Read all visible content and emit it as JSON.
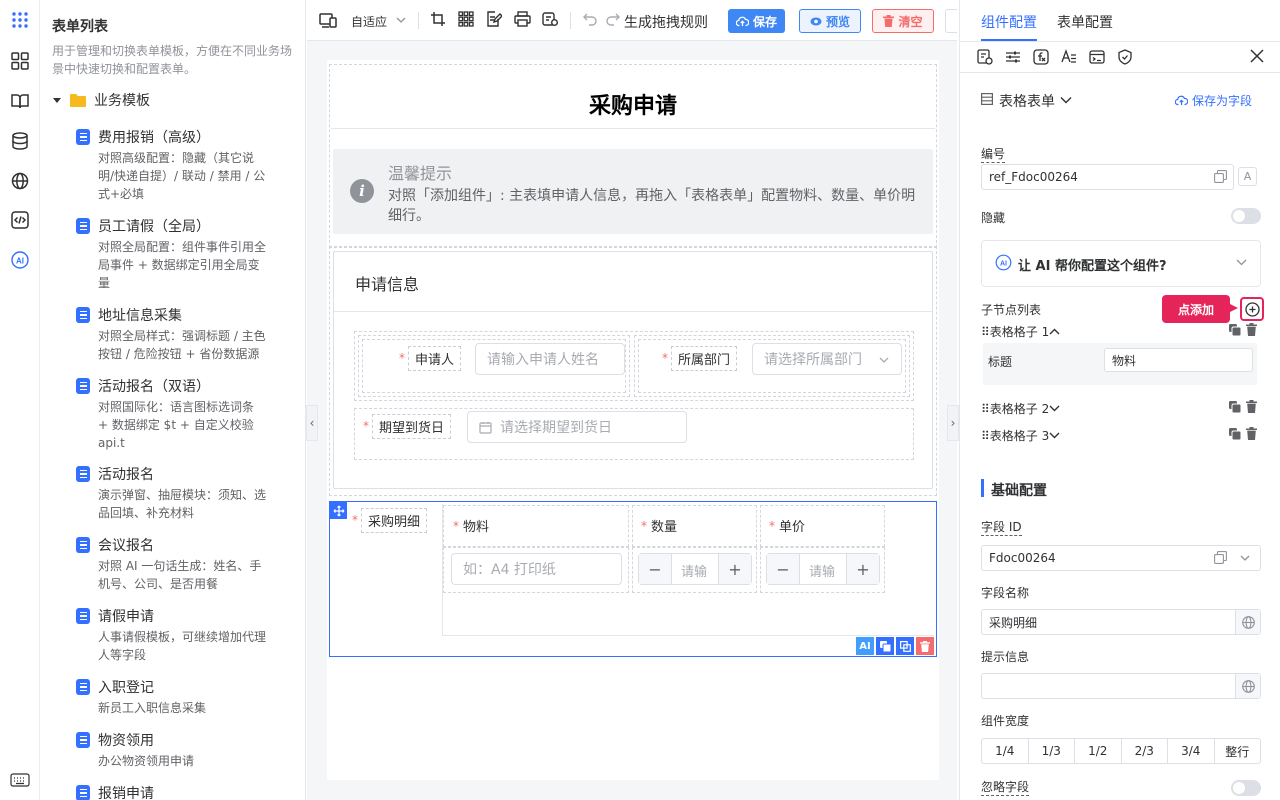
{
  "left": {
    "title": "表单列表",
    "description": "用于管理和切换表单模板，方便在不同业务场景中快速切换和配置表单。",
    "folder": "业务模板",
    "templates": [
      {
        "name": "费用报销（高级）",
        "desc": "对照高级配置：隐藏（其它说明/快递自提）/ 联动 / 禁用 / 公式+必填"
      },
      {
        "name": "员工请假（全局）",
        "desc": "对照全局配置：组件事件引用全局事件 + 数据绑定引用全局变量"
      },
      {
        "name": "地址信息采集",
        "desc": "对照全局样式：强调标题 / 主色按钮 / 危险按钮 + 省份数据源"
      },
      {
        "name": "活动报名（双语）",
        "desc": "对照国际化：语言图标选词条 + 数据绑定 $t + 自定义校验 api.t"
      },
      {
        "name": "活动报名",
        "desc": "演示弹窗、抽屉模块：须知、选品回填、补充材料"
      },
      {
        "name": "会议报名",
        "desc": "对照 AI 一句话生成：姓名、手机号、公司、是否用餐"
      },
      {
        "name": "请假申请",
        "desc": "人事请假模板，可继续增加代理人等字段"
      },
      {
        "name": "入职登记",
        "desc": "新员工入职信息采集"
      },
      {
        "name": "物资领用",
        "desc": "办公物资领用申请"
      },
      {
        "name": "报销申请",
        "desc": ""
      }
    ]
  },
  "toolbar": {
    "adaptive": "自适应",
    "gen_rules": "生成拖拽规则",
    "save": "保存",
    "preview": "预览",
    "clear": "清空"
  },
  "canvas": {
    "form_title": "采购申请",
    "tip_title": "温馨提示",
    "tip_text": "对照「添加组件」: 主表填申请人信息，再拖入「表格表单」配置物料、数量、单价明细行。",
    "section_title": "申请信息",
    "applicant_label": "申请人",
    "applicant_placeholder": "请输入申请人姓名",
    "dept_label": "所属部门",
    "dept_placeholder": "请选择所属部门",
    "date_label": "期望到货日",
    "date_placeholder": "请选择期望到货日",
    "detail_label": "采购明细",
    "col_material": "物料",
    "col_qty": "数量",
    "col_price": "单价",
    "material_placeholder": "如：A4 打印纸",
    "qty_placeholder": "请输",
    "price_placeholder": "请输",
    "ai_badge": "AI"
  },
  "right": {
    "tab_component": "组件配置",
    "tab_form": "表单配置",
    "component_type": "表格表单",
    "save_as_field": "保存为字段",
    "number_label": "编号",
    "number_value": "ref_Fdoc00264",
    "number_suffix": "A",
    "hidden_label": "隐藏",
    "ai_help": "让 AI 帮你配置这个组件?",
    "ai_badge": "AI",
    "children_label": "子节点列表",
    "callout": "点添加",
    "children": [
      "表格格子 1",
      "表格格子 2",
      "表格格子 3"
    ],
    "child_title_label": "标题",
    "child_title_value": "物料",
    "basic_section": "基础配置",
    "field_id_label": "字段 ID",
    "field_id_value": "Fdoc00264",
    "field_name_label": "字段名称",
    "field_name_value": "采购明细",
    "tip_label": "提示信息",
    "tip_value": "",
    "width_label": "组件宽度",
    "widths": [
      "1/4",
      "1/3",
      "1/2",
      "2/3",
      "3/4",
      "整行"
    ],
    "ignore_label": "忽略字段"
  }
}
